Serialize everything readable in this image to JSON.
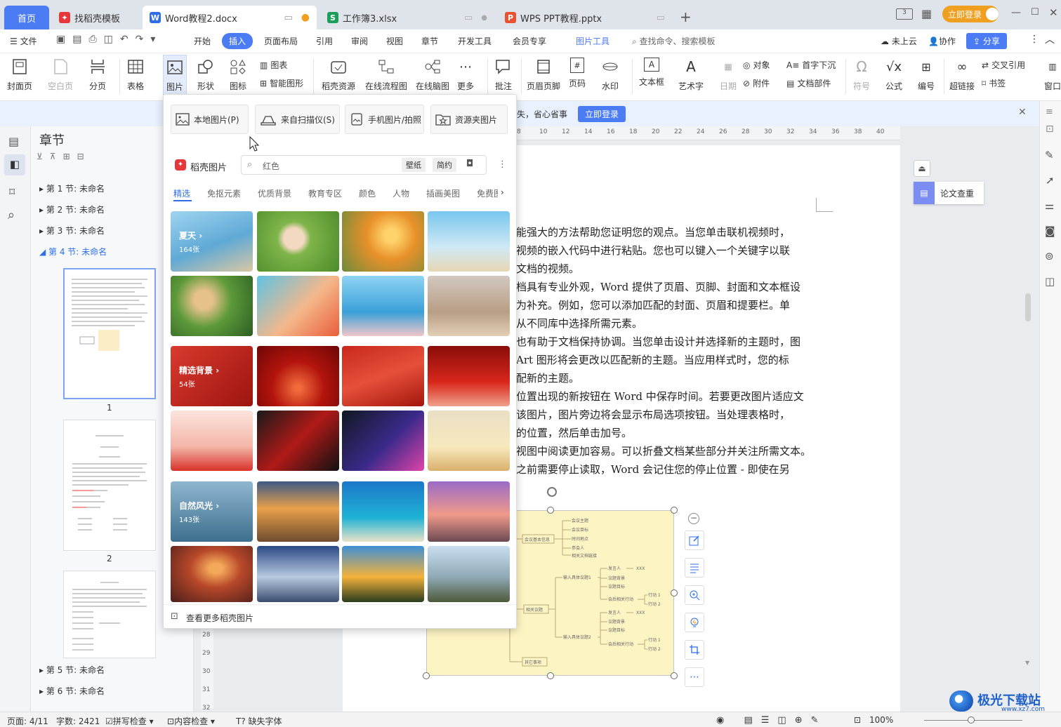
{
  "tabs": [
    {
      "label": "首页"
    },
    {
      "label": "找稻壳模板"
    },
    {
      "label": "Word教程2.docx"
    },
    {
      "label": "工作簿3.xlsx"
    },
    {
      "label": "WPS PPT教程.pptx"
    }
  ],
  "window": {
    "login_label": "立即登录"
  },
  "menu": {
    "file": "文件",
    "items": [
      "开始",
      "插入",
      "页面布局",
      "引用",
      "审阅",
      "视图",
      "章节",
      "开发工具",
      "会员专享"
    ],
    "picture_tools": "图片工具",
    "search_placeholder": "查找命令、搜索模板",
    "cloud": "未上云",
    "collab": "协作",
    "share": "分享"
  },
  "ribbon": {
    "cover": "封面页",
    "blank": "空白页",
    "pagebreak": "分页",
    "table": "表格",
    "picture": "图片",
    "shape": "形状",
    "icon": "图标",
    "chart": "图表",
    "smartart": "智能图形",
    "daoke": "稻壳资源",
    "flow": "在线流程图",
    "mind": "在线脑图",
    "more": "更多",
    "comment": "批注",
    "header": "页眉页脚",
    "pagenum": "页码",
    "watermark": "水印",
    "textbox": "文本框",
    "wordart": "艺术字",
    "date": "日期",
    "object": "对象",
    "dropcap": "首字下沉",
    "attach": "附件",
    "docpart": "文档部件",
    "symbol": "符号",
    "formula": "公式",
    "number": "编号",
    "hyperlink": "超链接",
    "crossref": "交叉引用",
    "bookmark": "书签",
    "window": "窗口"
  },
  "notice": {
    "text": "失，省心省事",
    "btn": "立即登录"
  },
  "nav": {
    "title": "章节",
    "sections": [
      "第 1 节: 未命名",
      "第 2 节: 未命名",
      "第 3 节: 未命名",
      "第 4 节: 未命名",
      "第 5 节: 未命名",
      "第 6 节: 未命名"
    ],
    "page1": "1",
    "page2": "2"
  },
  "dropdown": {
    "local": "本地图片(P)",
    "scan": "来自扫描仪(S)",
    "phone": "手机图片/拍照",
    "folder": "资源夹图片",
    "brand": "稻壳图片",
    "search": "红色",
    "wallpaper": "壁纸",
    "simple": "简约",
    "cats": [
      "精选",
      "免抠元素",
      "优质背景",
      "教育专区",
      "颜色",
      "人物",
      "插画美图",
      "免费图"
    ],
    "groups": [
      {
        "title": "夏天",
        "count": "164张"
      },
      {
        "title": "精选背景",
        "count": "54张"
      },
      {
        "title": "自然风光",
        "count": "143张"
      }
    ],
    "more": "查看更多稻壳图片"
  },
  "doc": {
    "lines": [
      "能强大的方法帮助您证明您的观点。当您单击联机视频时，",
      "视频的嵌入代码中进行粘贴。您也可以键入一个关键字以联",
      "文档的视频。",
      "档具有专业外观，Word 提供了页眉、页脚、封面和文本框设",
      "为补充。例如，您可以添加匹配的封面、页眉和提要栏。单",
      "从不同库中选择所需元素。",
      "也有助于文档保持协调。当您单击设计并选择新的主题时，图",
      "Art 图形将会更改以匹配新的主题。当应用样式时，您的标",
      "配新的主题。",
      "位置出现的新按钮在 Word 中保存时间。若要更改图片适应文",
      "该图片，图片旁边将会显示布局选项按钮。当处理表格时，",
      "的位置，然后单击加号。",
      "视图中阅读更加容易。可以折叠文档某些部分并关注所需文本。",
      "之前需要停止读取，Word 会记住您的停止位置 - 即使在另"
    ],
    "ruler": [
      "8",
      "10",
      "12",
      "14",
      "16",
      "18",
      "20",
      "22",
      "24",
      "26",
      "28",
      "30",
      "32",
      "34",
      "36",
      "38",
      "40"
    ],
    "vruler": [
      "28",
      "29",
      "30",
      "31",
      "32"
    ],
    "mindmap": {
      "n1": "会议基本信息",
      "n1a": "会议主题",
      "n1b": "会议目标",
      "n1c": "时间地点",
      "n1d": "参会人",
      "n1e": "相关文档链接",
      "n2": "相关议题",
      "n2a": "输入具体议题1",
      "n2b": "输入具体议题2",
      "p": "发言人",
      "x": "XXX",
      "bg": "议题背景",
      "tg": "议题目标",
      "act": "会后相关行动",
      "a1": "行动 1",
      "a2": "行动 2",
      "n3": "其它事项"
    }
  },
  "side": {
    "check": "论文查重"
  },
  "status": {
    "page": "页面: 4/11",
    "words": "字数: 2421",
    "spell": "拼写检查",
    "content": "内容检查",
    "font": "缺失字体",
    "zoom": "100%"
  },
  "watermark": {
    "text": "极光下载站",
    "url": "www.xz7.com"
  }
}
